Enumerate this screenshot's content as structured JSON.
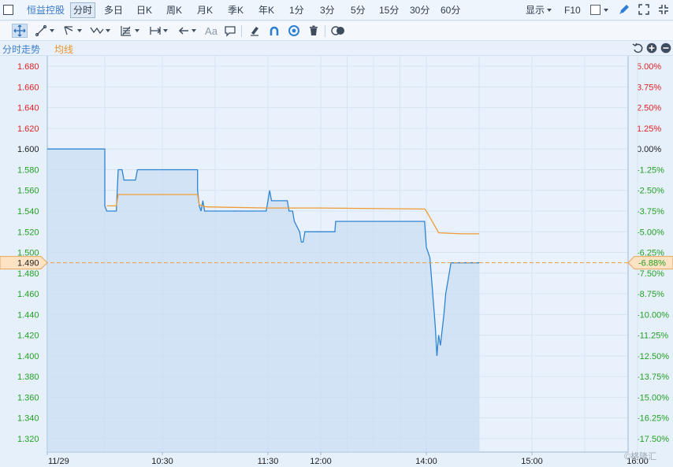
{
  "header": {
    "stock_name": "恒益控股",
    "periods": [
      "分时",
      "多日",
      "日K",
      "周K",
      "月K",
      "季K",
      "年K",
      "1分",
      "3分",
      "5分",
      "15分",
      "30分",
      "60分"
    ],
    "active_period": "分时",
    "display_label": "显示",
    "f10_label": "F10"
  },
  "toolbar": {
    "font_tool_label": "Aa"
  },
  "legend": {
    "price_label": "分时走势",
    "avg_label": "均线"
  },
  "colors": {
    "price_line": "#2f84d2",
    "price_fill": "#c9ddf4",
    "avg_line": "#f09a33",
    "up": "#e02222",
    "down": "#23a023",
    "neutral": "#222222",
    "ref_line": "#f0a040"
  },
  "watermark": "格隆汇",
  "chart_data": {
    "type": "line",
    "x_ticks": [
      "11/29",
      "10:30",
      "11:30",
      "12:00",
      "14:00",
      "15:00",
      "16:00"
    ],
    "y_ticks": [
      1.68,
      1.66,
      1.64,
      1.62,
      1.6,
      1.58,
      1.56,
      1.54,
      1.52,
      1.5,
      1.48,
      1.46,
      1.44,
      1.42,
      1.4,
      1.38,
      1.36,
      1.34,
      1.32
    ],
    "pct_ticks": [
      "5.00%",
      "3.75%",
      "2.50%",
      "1.25%",
      "0.00%",
      "-1.25%",
      "-2.50%",
      "-3.75%",
      "-5.00%",
      "-6.25%",
      "-7.50%",
      "-8.75%",
      "-10.00%",
      "-11.25%",
      "-12.50%",
      "-13.75%",
      "-15.00%",
      "-16.25%",
      "-17.50%"
    ],
    "prev_close": 1.6,
    "current_price": "1.490",
    "current_pct": "-6.88%",
    "series": [
      {
        "values": [
          [
            "09:30",
            1.6
          ],
          [
            "10:00",
            1.6
          ],
          [
            "10:00",
            1.545
          ],
          [
            "10:01",
            1.54
          ],
          [
            "10:06",
            1.54
          ],
          [
            "10:07",
            1.58
          ],
          [
            "10:09",
            1.58
          ],
          [
            "10:10",
            1.57
          ],
          [
            "10:15",
            1.57
          ],
          [
            "10:16",
            1.57
          ],
          [
            "10:17",
            1.58
          ],
          [
            "10:50",
            1.58
          ],
          [
            "10:50",
            1.56
          ],
          [
            "10:51",
            1.545
          ],
          [
            "10:52",
            1.54
          ],
          [
            "10:53",
            1.55
          ],
          [
            "10:54",
            1.54
          ],
          [
            "11:29",
            1.54
          ],
          [
            "11:30",
            1.55
          ],
          [
            "11:31",
            1.56
          ],
          [
            "11:32",
            1.55
          ],
          [
            "11:41",
            1.55
          ],
          [
            "11:42",
            1.54
          ],
          [
            "11:44",
            1.54
          ],
          [
            "11:45",
            1.53
          ],
          [
            "11:48",
            1.52
          ],
          [
            "11:49",
            1.51
          ],
          [
            "11:50",
            1.51
          ],
          [
            "11:51",
            1.52
          ],
          [
            "11:52",
            1.52
          ],
          [
            "12:02",
            1.52
          ],
          [
            "12:03",
            1.52
          ],
          [
            "12:16",
            1.52
          ],
          [
            "12:17",
            1.53
          ],
          [
            "13:58",
            1.53
          ],
          [
            "14:00",
            1.505
          ],
          [
            "14:02",
            1.495
          ],
          [
            "14:05",
            1.43
          ],
          [
            "14:06",
            1.4
          ],
          [
            "14:07",
            1.42
          ],
          [
            "14:08",
            1.41
          ],
          [
            "14:10",
            1.44
          ],
          [
            "14:11",
            1.46
          ],
          [
            "14:12",
            1.47
          ],
          [
            "14:14",
            1.49
          ],
          [
            "14:30",
            1.49
          ]
        ]
      },
      {
        "values": [
          [
            "10:01",
            1.545
          ],
          [
            "10:06",
            1.545
          ],
          [
            "10:07",
            1.556
          ],
          [
            "10:50",
            1.556
          ],
          [
            "10:51",
            1.546
          ],
          [
            "10:55",
            1.544
          ],
          [
            "11:30",
            1.543
          ],
          [
            "12:00",
            1.543
          ],
          [
            "13:58",
            1.542
          ],
          [
            "14:00",
            1.54
          ],
          [
            "14:05",
            1.525
          ],
          [
            "14:07",
            1.519
          ],
          [
            "14:20",
            1.518
          ],
          [
            "14:30",
            1.518
          ]
        ]
      }
    ]
  }
}
